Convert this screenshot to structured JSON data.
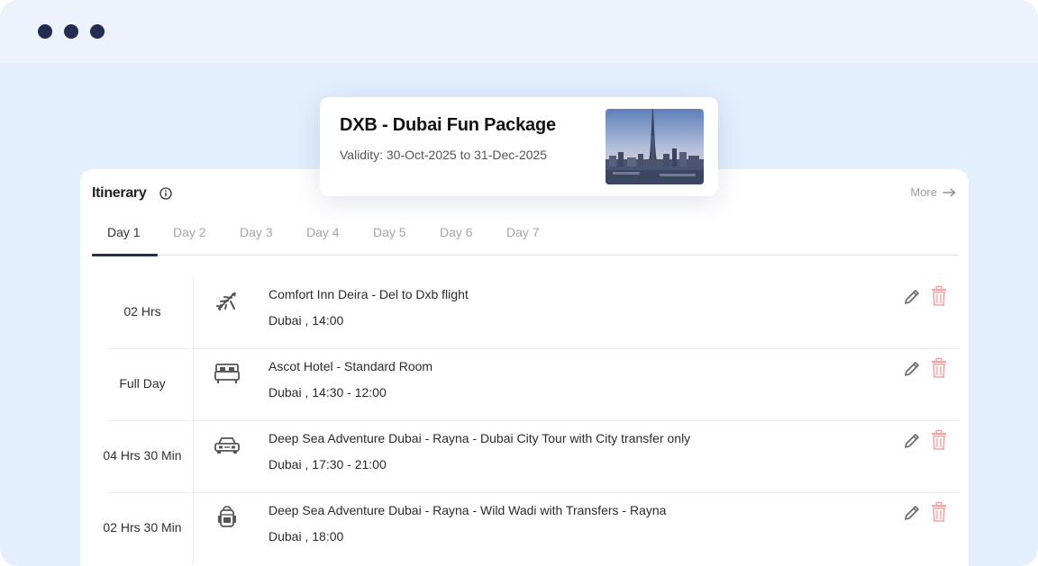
{
  "window": {
    "controls": [
      "close",
      "minimize",
      "maximize"
    ]
  },
  "package": {
    "title": "DXB - Dubai Fun Package",
    "validity": "Validity: 30-Oct-2025 to 31-Dec-2025",
    "image": "dubai-skyline-photo"
  },
  "itinerary": {
    "title": "Itinerary",
    "more_label": "More",
    "tabs": [
      {
        "label": "Day 1",
        "active": true
      },
      {
        "label": "Day 2",
        "active": false
      },
      {
        "label": "Day 3",
        "active": false
      },
      {
        "label": "Day 4",
        "active": false
      },
      {
        "label": "Day 5",
        "active": false
      },
      {
        "label": "Day 6",
        "active": false
      },
      {
        "label": "Day 7",
        "active": false
      }
    ],
    "rows": [
      {
        "duration": "02 Hrs",
        "icon": "flight-icon",
        "title": "Comfort Inn Deira  -  Del to Dxb flight",
        "subtitle": "Dubai , 14:00"
      },
      {
        "duration": "Full Day",
        "icon": "bed-icon",
        "title": "Ascot Hotel  -  Standard Room",
        "subtitle": "Dubai , 14:30 - 12:00"
      },
      {
        "duration": "04 Hrs 30 Min",
        "icon": "car-icon",
        "title": "Deep Sea Adventure Dubai - Rayna  -  Dubai City Tour with City transfer only",
        "subtitle": "Dubai , 17:30 - 21:00"
      },
      {
        "duration": "02 Hrs 30 Min",
        "icon": "backpack-icon",
        "title": "Deep Sea Adventure Dubai - Rayna  -  Wild Wadi with Transfers - Rayna",
        "subtitle": "Dubai , 18:00"
      }
    ]
  },
  "colors": {
    "dots": "#232d52",
    "background": "#e3eefe",
    "titlebar": "#eef2fd",
    "delete": "#f2a5a5"
  }
}
